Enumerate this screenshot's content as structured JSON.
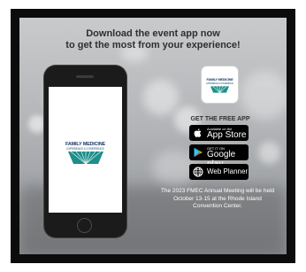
{
  "headline": {
    "line1": "Download the event app now",
    "line2": "to get the most from your experience!"
  },
  "logo": {
    "line1": "FAMILY MEDICINE",
    "line2": "EXPERIENCE & CONFERENCE"
  },
  "get_app": {
    "heading": "GET THE FREE APP"
  },
  "badges": {
    "appstore": {
      "small": "Available on the",
      "big": "App Store",
      "icon": "apple-icon"
    },
    "googleplay": {
      "small": "GET IT ON",
      "big": "Google play",
      "icon": "play-icon"
    },
    "webplanner": {
      "big": "Web Planner",
      "icon": "globe-icon"
    }
  },
  "note": {
    "line1": "The 2023 FMEC Annual Meeting will be held",
    "line2": "October 13-15 at the Rhode Island",
    "line3": "Convention Center."
  }
}
